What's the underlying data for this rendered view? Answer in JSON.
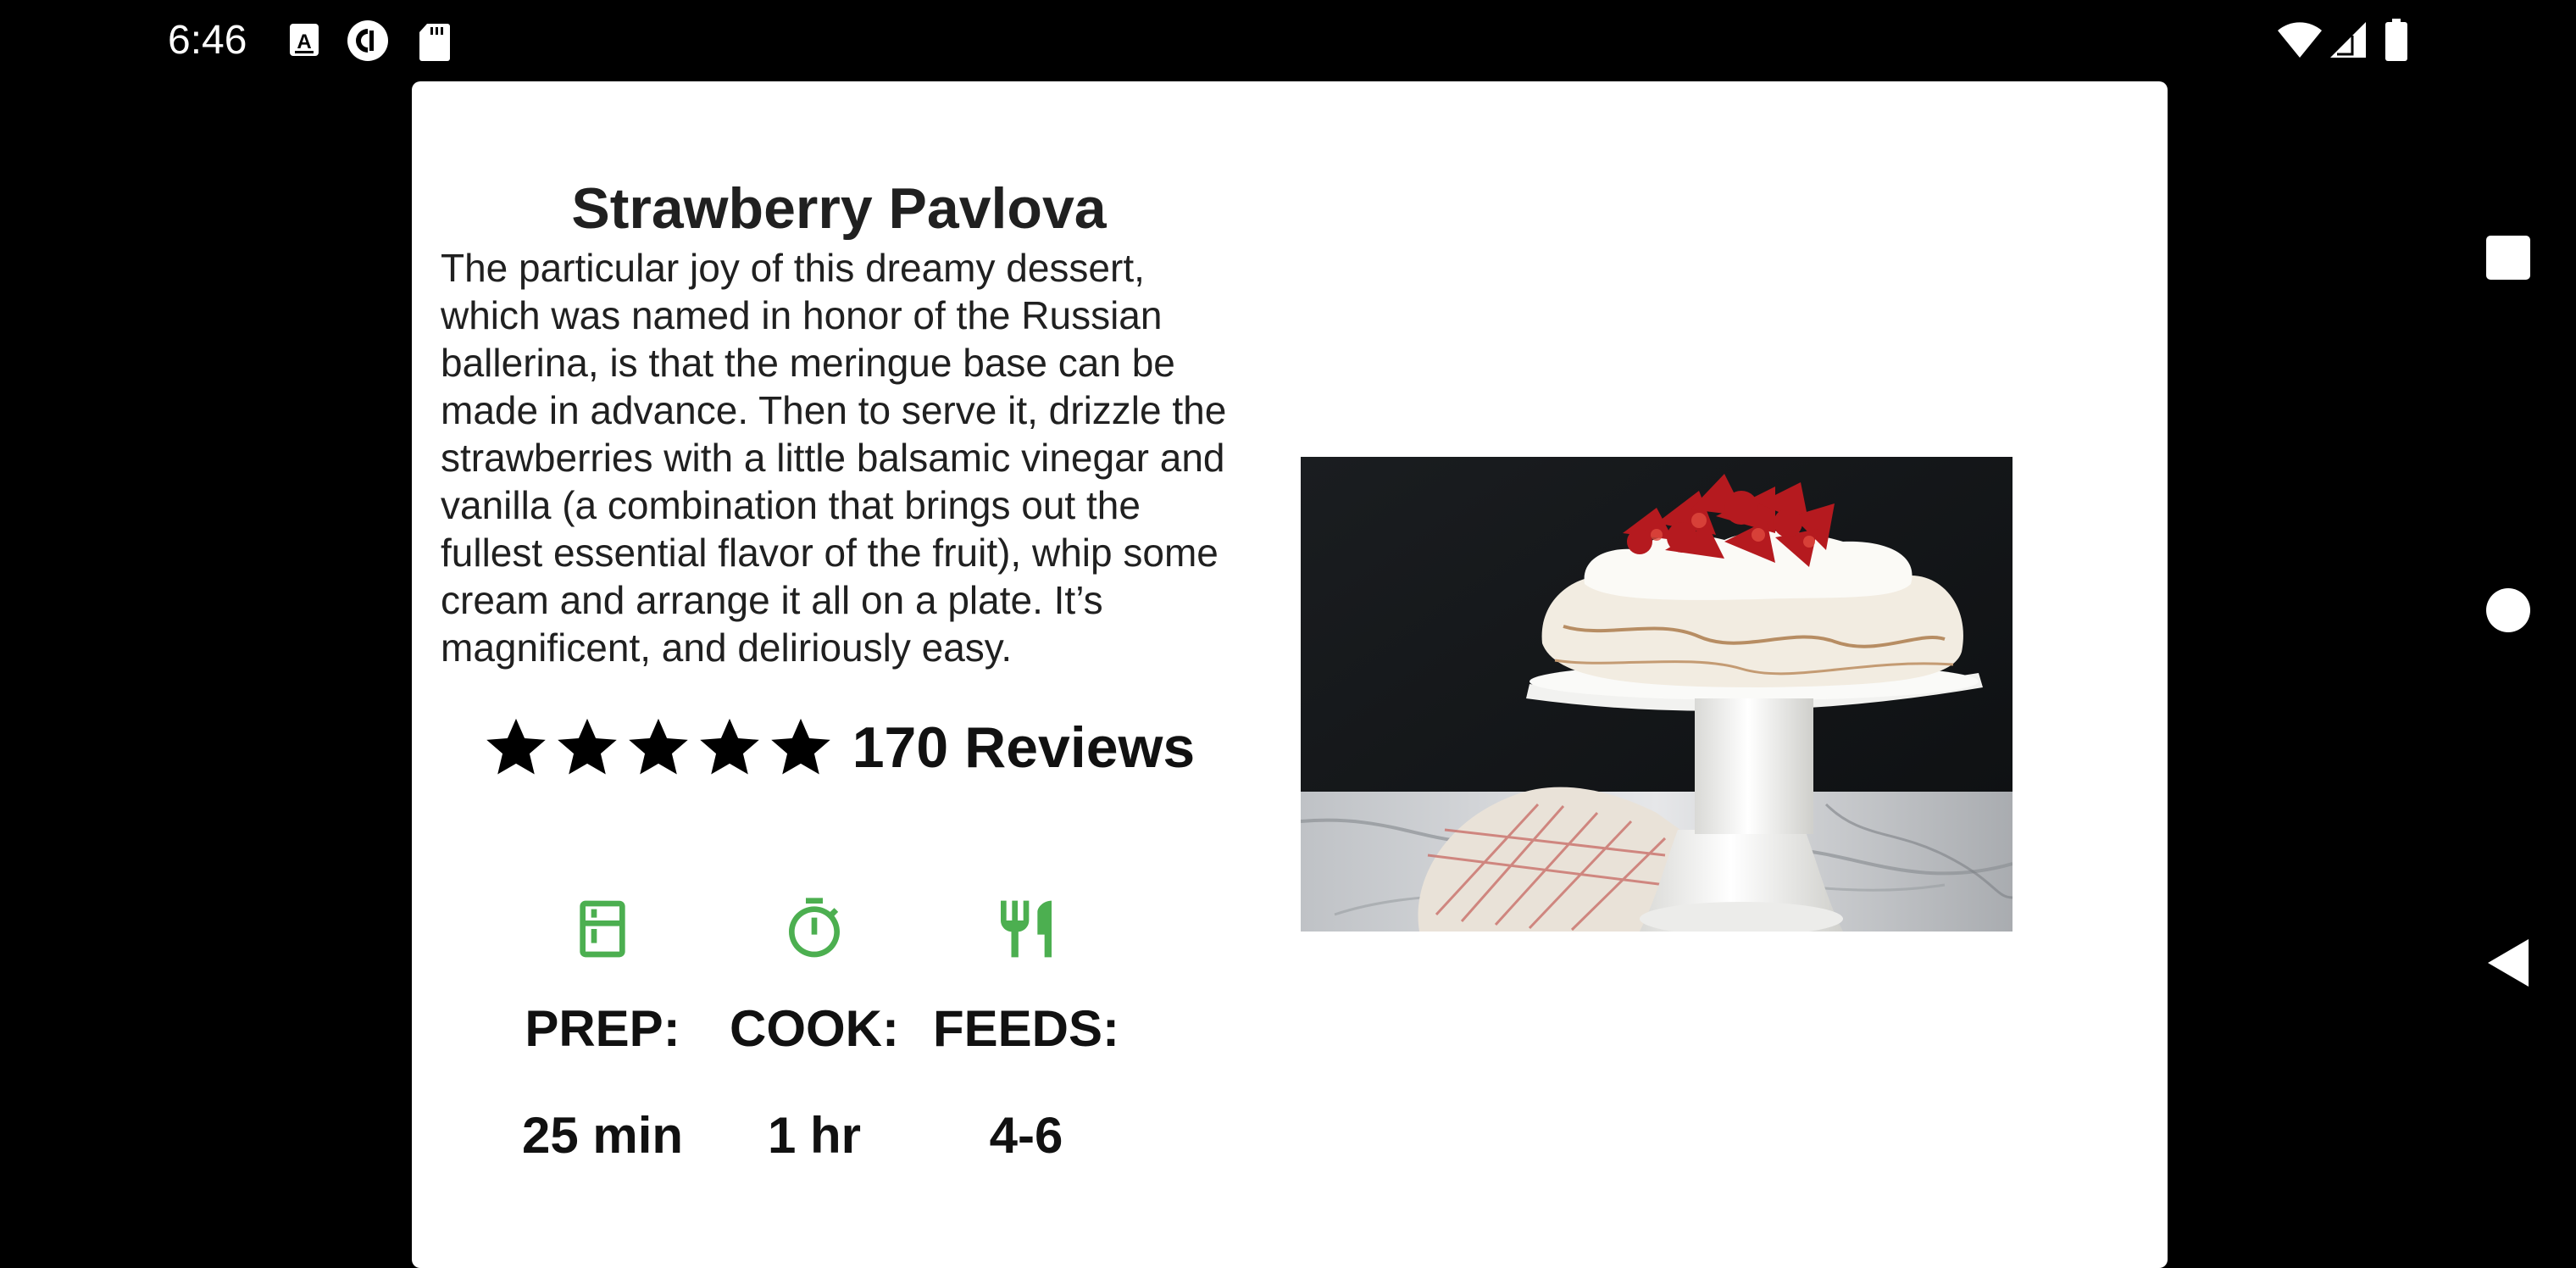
{
  "status_bar": {
    "time": "6:46",
    "left_icons": [
      "a-icon",
      "pocket-casts-icon",
      "sd-card-icon"
    ],
    "right_icons": [
      "wifi-icon",
      "signal-icon",
      "battery-icon"
    ]
  },
  "recipe": {
    "title": "Strawberry Pavlova",
    "description": "The particular joy of this dreamy dessert, which was named in honor of the Russian ballerina, is that the meringue base can be made in advance. Then to serve it, drizzle the strawberries with a little balsamic vinegar and vanilla (a combination that brings out the fullest essential flavor of the fruit), whip some cream and arrange it all on a plate. It’s magnificent, and deliriously easy.",
    "rating": 5,
    "reviews": "170 Reviews",
    "details": [
      {
        "icon": "kitchen-icon",
        "label": "PREP:",
        "value": "25 min"
      },
      {
        "icon": "timer-icon",
        "label": "COOK:",
        "value": "1 hr"
      },
      {
        "icon": "restaurant-icon",
        "label": "FEEDS:",
        "value": "4-6"
      }
    ]
  },
  "colors": {
    "accent": "#4CAF50",
    "card": "#FFFFFF",
    "background": "#000000"
  },
  "nav_bar": [
    "recents-button",
    "home-button",
    "back-button"
  ]
}
